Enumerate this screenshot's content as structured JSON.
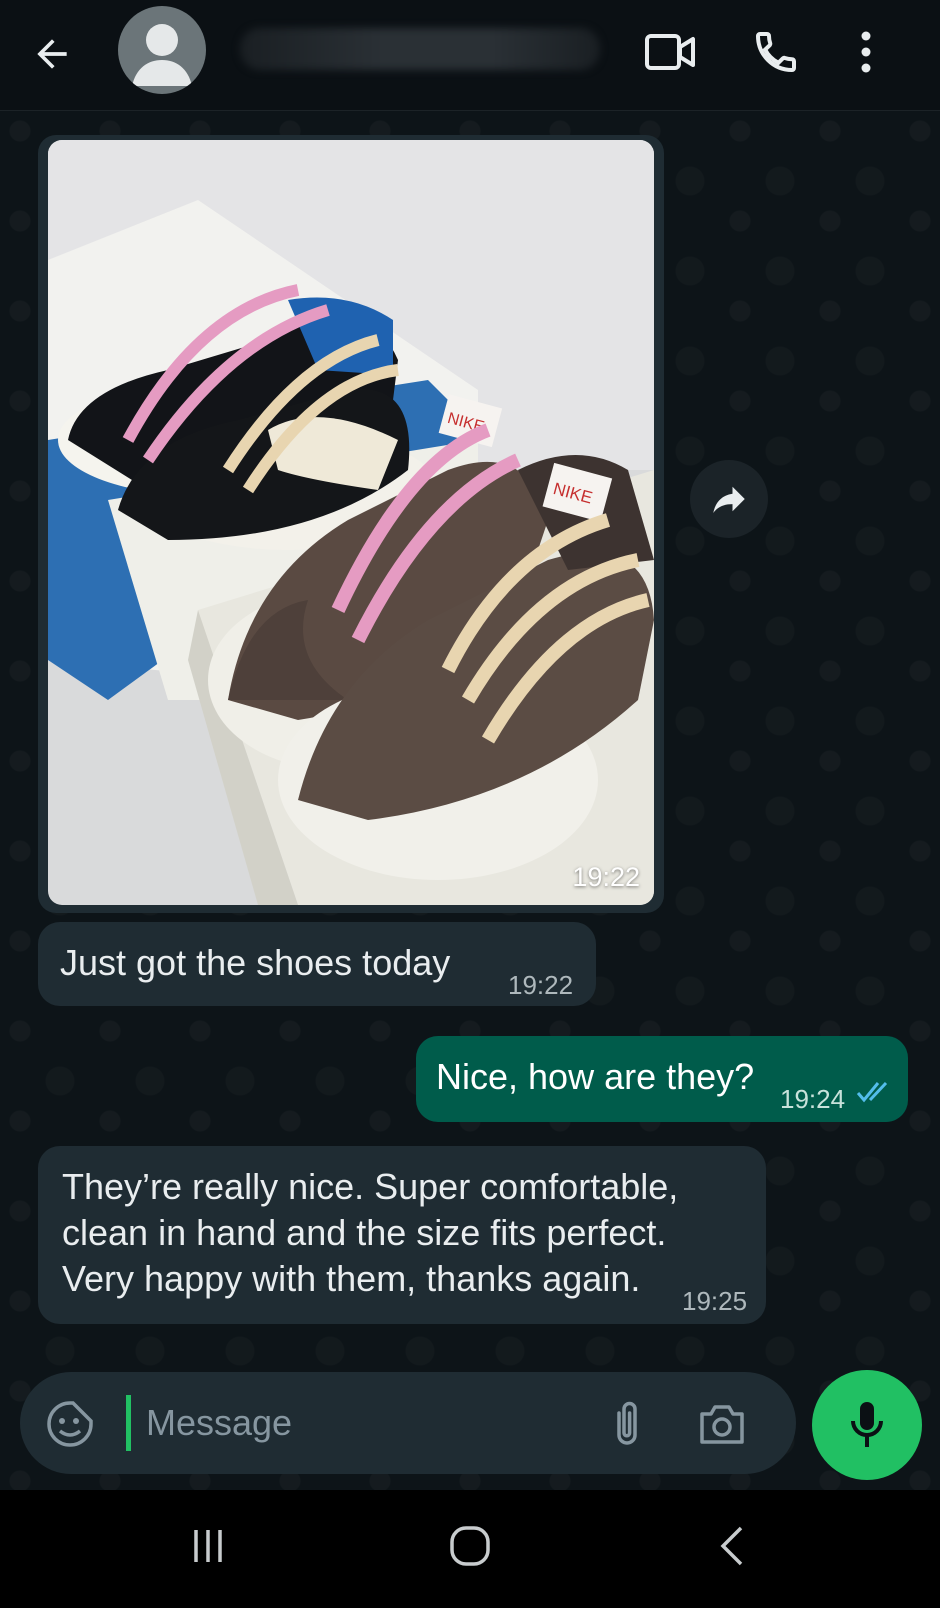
{
  "header": {
    "contact_name": "",
    "back_icon": "arrow-left-icon",
    "video_icon": "video-camera-icon",
    "call_icon": "phone-icon",
    "menu_icon": "more-vertical-icon"
  },
  "messages": [
    {
      "type": "image",
      "direction": "incoming",
      "time": "19:22",
      "description": "photo"
    },
    {
      "type": "text",
      "direction": "incoming",
      "text": "Just got the shoes today",
      "time": "19:22"
    },
    {
      "type": "text",
      "direction": "outgoing",
      "text": "Nice, how are they?",
      "time": "19:24",
      "status": "read"
    },
    {
      "type": "text",
      "direction": "incoming",
      "lines": [
        "They’re really nice. Super comfortable,",
        "clean in hand and the size fits perfect.",
        "Very happy with them, thanks again."
      ],
      "time": "19:25"
    }
  ],
  "composer": {
    "placeholder": "Message",
    "emoji_icon": "sticker-icon",
    "attach_icon": "paperclip-icon",
    "camera_icon": "camera-icon",
    "mic_icon": "microphone-icon"
  },
  "colors": {
    "accent": "#21c063",
    "outgoing_bubble": "#005c4b",
    "incoming_bubble": "#1f2c33",
    "read_ticks": "#53bdeb"
  }
}
